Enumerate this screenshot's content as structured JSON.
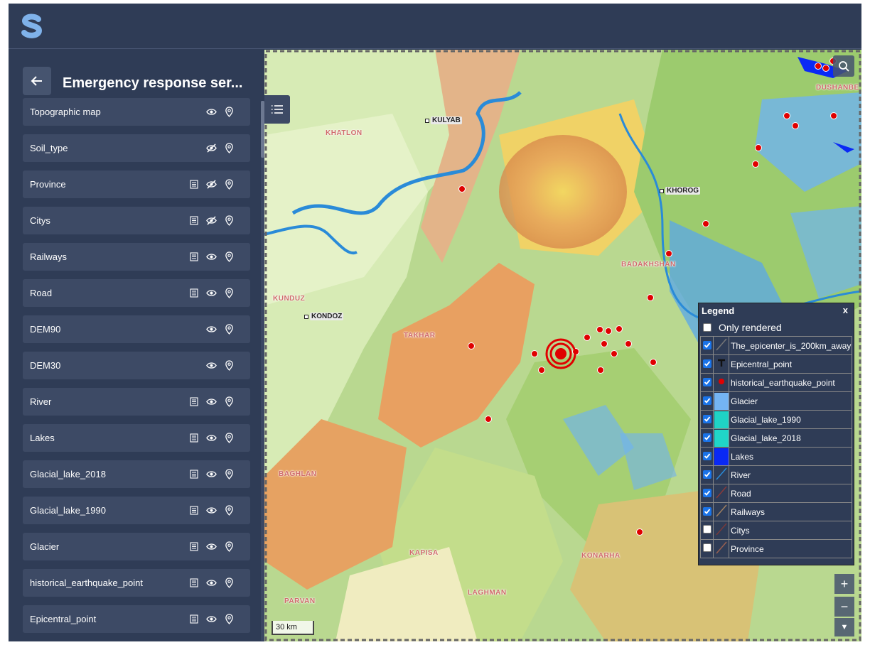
{
  "app": {
    "logo_icon": "s-logo-icon",
    "accent": "#6ea6e8",
    "bg": "#2f3c56"
  },
  "sidebar": {
    "back_icon": "arrow-left-icon",
    "title": "Emergency response ser...",
    "layers": [
      {
        "label": "Topographic map",
        "has_table": false,
        "visible": true
      },
      {
        "label": "Soil_type",
        "has_table": false,
        "visible": false
      },
      {
        "label": "Province",
        "has_table": true,
        "visible": false
      },
      {
        "label": "Citys",
        "has_table": true,
        "visible": false
      },
      {
        "label": "Railways",
        "has_table": true,
        "visible": true
      },
      {
        "label": "Road",
        "has_table": true,
        "visible": true
      },
      {
        "label": "DEM90",
        "has_table": false,
        "visible": true
      },
      {
        "label": "DEM30",
        "has_table": false,
        "visible": true
      },
      {
        "label": "River",
        "has_table": true,
        "visible": true
      },
      {
        "label": "Lakes",
        "has_table": true,
        "visible": true
      },
      {
        "label": "Glacial_lake_2018",
        "has_table": true,
        "visible": true
      },
      {
        "label": "Glacial_lake_1990",
        "has_table": true,
        "visible": true
      },
      {
        "label": "Glacier",
        "has_table": true,
        "visible": true
      },
      {
        "label": "historical_earthquake_point",
        "has_table": true,
        "visible": true
      },
      {
        "label": "Epicentral_point",
        "has_table": true,
        "visible": true
      }
    ]
  },
  "map": {
    "region_labels": [
      "KHATLON",
      "BADAKHSHAN",
      "KUNDUZ",
      "TAKHAR",
      "BAGHLAN",
      "KAPISA",
      "KONARHA",
      "PARVAN",
      "LAGHMAN"
    ],
    "city_labels": [
      "KULYAB",
      "KHOROG",
      "KONDOZ",
      "DUSHANBE"
    ],
    "scale_text": "30 km",
    "zoom_in": "+",
    "zoom_out": "−",
    "compass": "▼"
  },
  "legend": {
    "title": "Legend",
    "close": "x",
    "only_rendered": "Only rendered",
    "items": [
      {
        "label": "The_epicenter_is_200km_away",
        "checked": true,
        "swatch": "line",
        "color": "#777777"
      },
      {
        "label": "Epicentral_point",
        "checked": true,
        "swatch": "T",
        "color": "#111111"
      },
      {
        "label": "historical_earthquake_point",
        "checked": true,
        "swatch": "dot",
        "color": "#e00000"
      },
      {
        "label": "Glacier",
        "checked": true,
        "swatch": "fill",
        "color": "#74b4f3"
      },
      {
        "label": "Glacial_lake_1990",
        "checked": true,
        "swatch": "fill",
        "color": "#1fd3c5"
      },
      {
        "label": "Glacial_lake_2018",
        "checked": true,
        "swatch": "fill",
        "color": "#20d6c8"
      },
      {
        "label": "Lakes",
        "checked": true,
        "swatch": "fill",
        "color": "#0a29f5"
      },
      {
        "label": "River",
        "checked": true,
        "swatch": "line",
        "color": "#2a8bd8"
      },
      {
        "label": "Road",
        "checked": true,
        "swatch": "line",
        "color": "#8a3a3a"
      },
      {
        "label": "Railways",
        "checked": true,
        "swatch": "line",
        "color": "#a08060"
      },
      {
        "label": "Citys",
        "checked": false,
        "swatch": "line",
        "color": "#7a3a3a"
      },
      {
        "label": "Province",
        "checked": false,
        "swatch": "line",
        "color": "#9a6050"
      }
    ]
  }
}
